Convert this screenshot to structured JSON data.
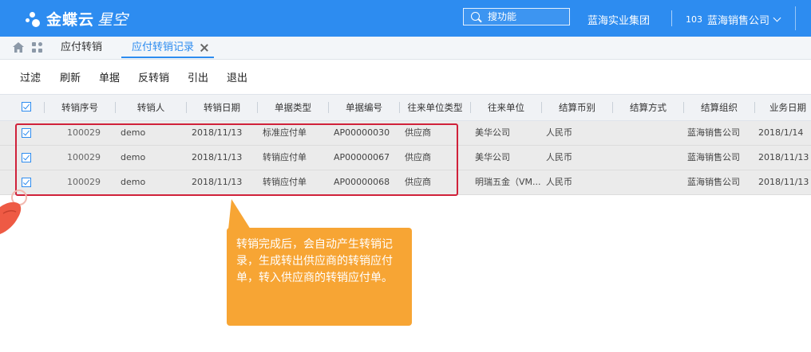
{
  "app": {
    "logo": "金蝶云",
    "logo_sub": "星空",
    "search_placeholder": "搜功能",
    "org_name": "蓝海实业集团",
    "account_code": "103",
    "account_name": "蓝海销售公司"
  },
  "tabs": [
    {
      "label": "应付转销",
      "active": false
    },
    {
      "label": "应付转销记录",
      "active": true
    }
  ],
  "toolbar": [
    "过滤",
    "刷新",
    "单据",
    "反转销",
    "引出",
    "退出"
  ],
  "columns": [
    "转销序号",
    "转销人",
    "转销日期",
    "单据类型",
    "单据编号",
    "往来单位类型",
    "往来单位",
    "结算币别",
    "结算方式",
    "结算组织",
    "业务日期"
  ],
  "rows": [
    {
      "seq": "100029",
      "user": "demo",
      "date": "2018/11/13",
      "type": "标准应付单",
      "no": "AP00000030",
      "cp_type": "供应商",
      "cp": "美华公司",
      "currency": "人民币",
      "method": "",
      "org": "蓝海销售公司",
      "biz_date": "2018/1/14"
    },
    {
      "seq": "100029",
      "user": "demo",
      "date": "2018/11/13",
      "type": "转销应付单",
      "no": "AP00000067",
      "cp_type": "供应商",
      "cp": "美华公司",
      "currency": "人民币",
      "method": "",
      "org": "蓝海销售公司",
      "biz_date": "2018/11/13"
    },
    {
      "seq": "100029",
      "user": "demo",
      "date": "2018/11/13",
      "type": "转销应付单",
      "no": "AP00000068",
      "cp_type": "供应商",
      "cp": "明瑞五金（VM...",
      "currency": "人民币",
      "method": "",
      "org": "蓝海销售公司",
      "biz_date": "2018/11/13"
    }
  ],
  "callout": "转销完成后，会自动产生转销记录，生成转出供应商的转销应付单，转入供应商的转销应付单。",
  "colors": {
    "brand": "#2d8cf0",
    "highlight": "#d0213a",
    "callout": "#f7a534"
  }
}
